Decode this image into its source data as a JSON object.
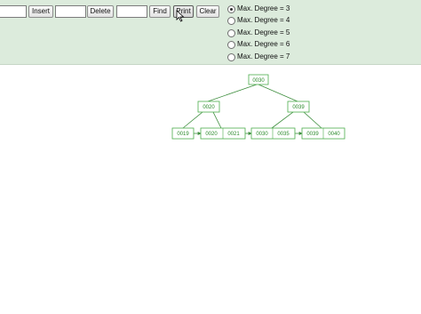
{
  "toolbar": {
    "insert_value": "",
    "insert_label": "Insert",
    "delete_value": "",
    "delete_label": "Delete",
    "find_value": "",
    "find_label": "Find",
    "print_label": "Print",
    "clear_label": "Clear"
  },
  "degree_options": [
    {
      "label": "Max. Degree = 3",
      "checked": true
    },
    {
      "label": "Max. Degree = 4",
      "checked": false
    },
    {
      "label": "Max. Degree = 5",
      "checked": false
    },
    {
      "label": "Max. Degree = 6",
      "checked": false
    },
    {
      "label": "Max. Degree = 7",
      "checked": false
    }
  ],
  "tree": {
    "root": [
      "0030"
    ],
    "internal_left": [
      "0020"
    ],
    "internal_right": [
      "0039"
    ],
    "leaves": [
      [
        "0019"
      ],
      [
        "0020",
        "0021"
      ],
      [
        "0030",
        "0035"
      ],
      [
        "0039",
        "0040"
      ]
    ]
  },
  "colors": {
    "toolbar_bg": "#dcebdc",
    "node_border": "#4cae4c",
    "node_text": "#2a8a2a",
    "edge": "#3e8e3e"
  }
}
